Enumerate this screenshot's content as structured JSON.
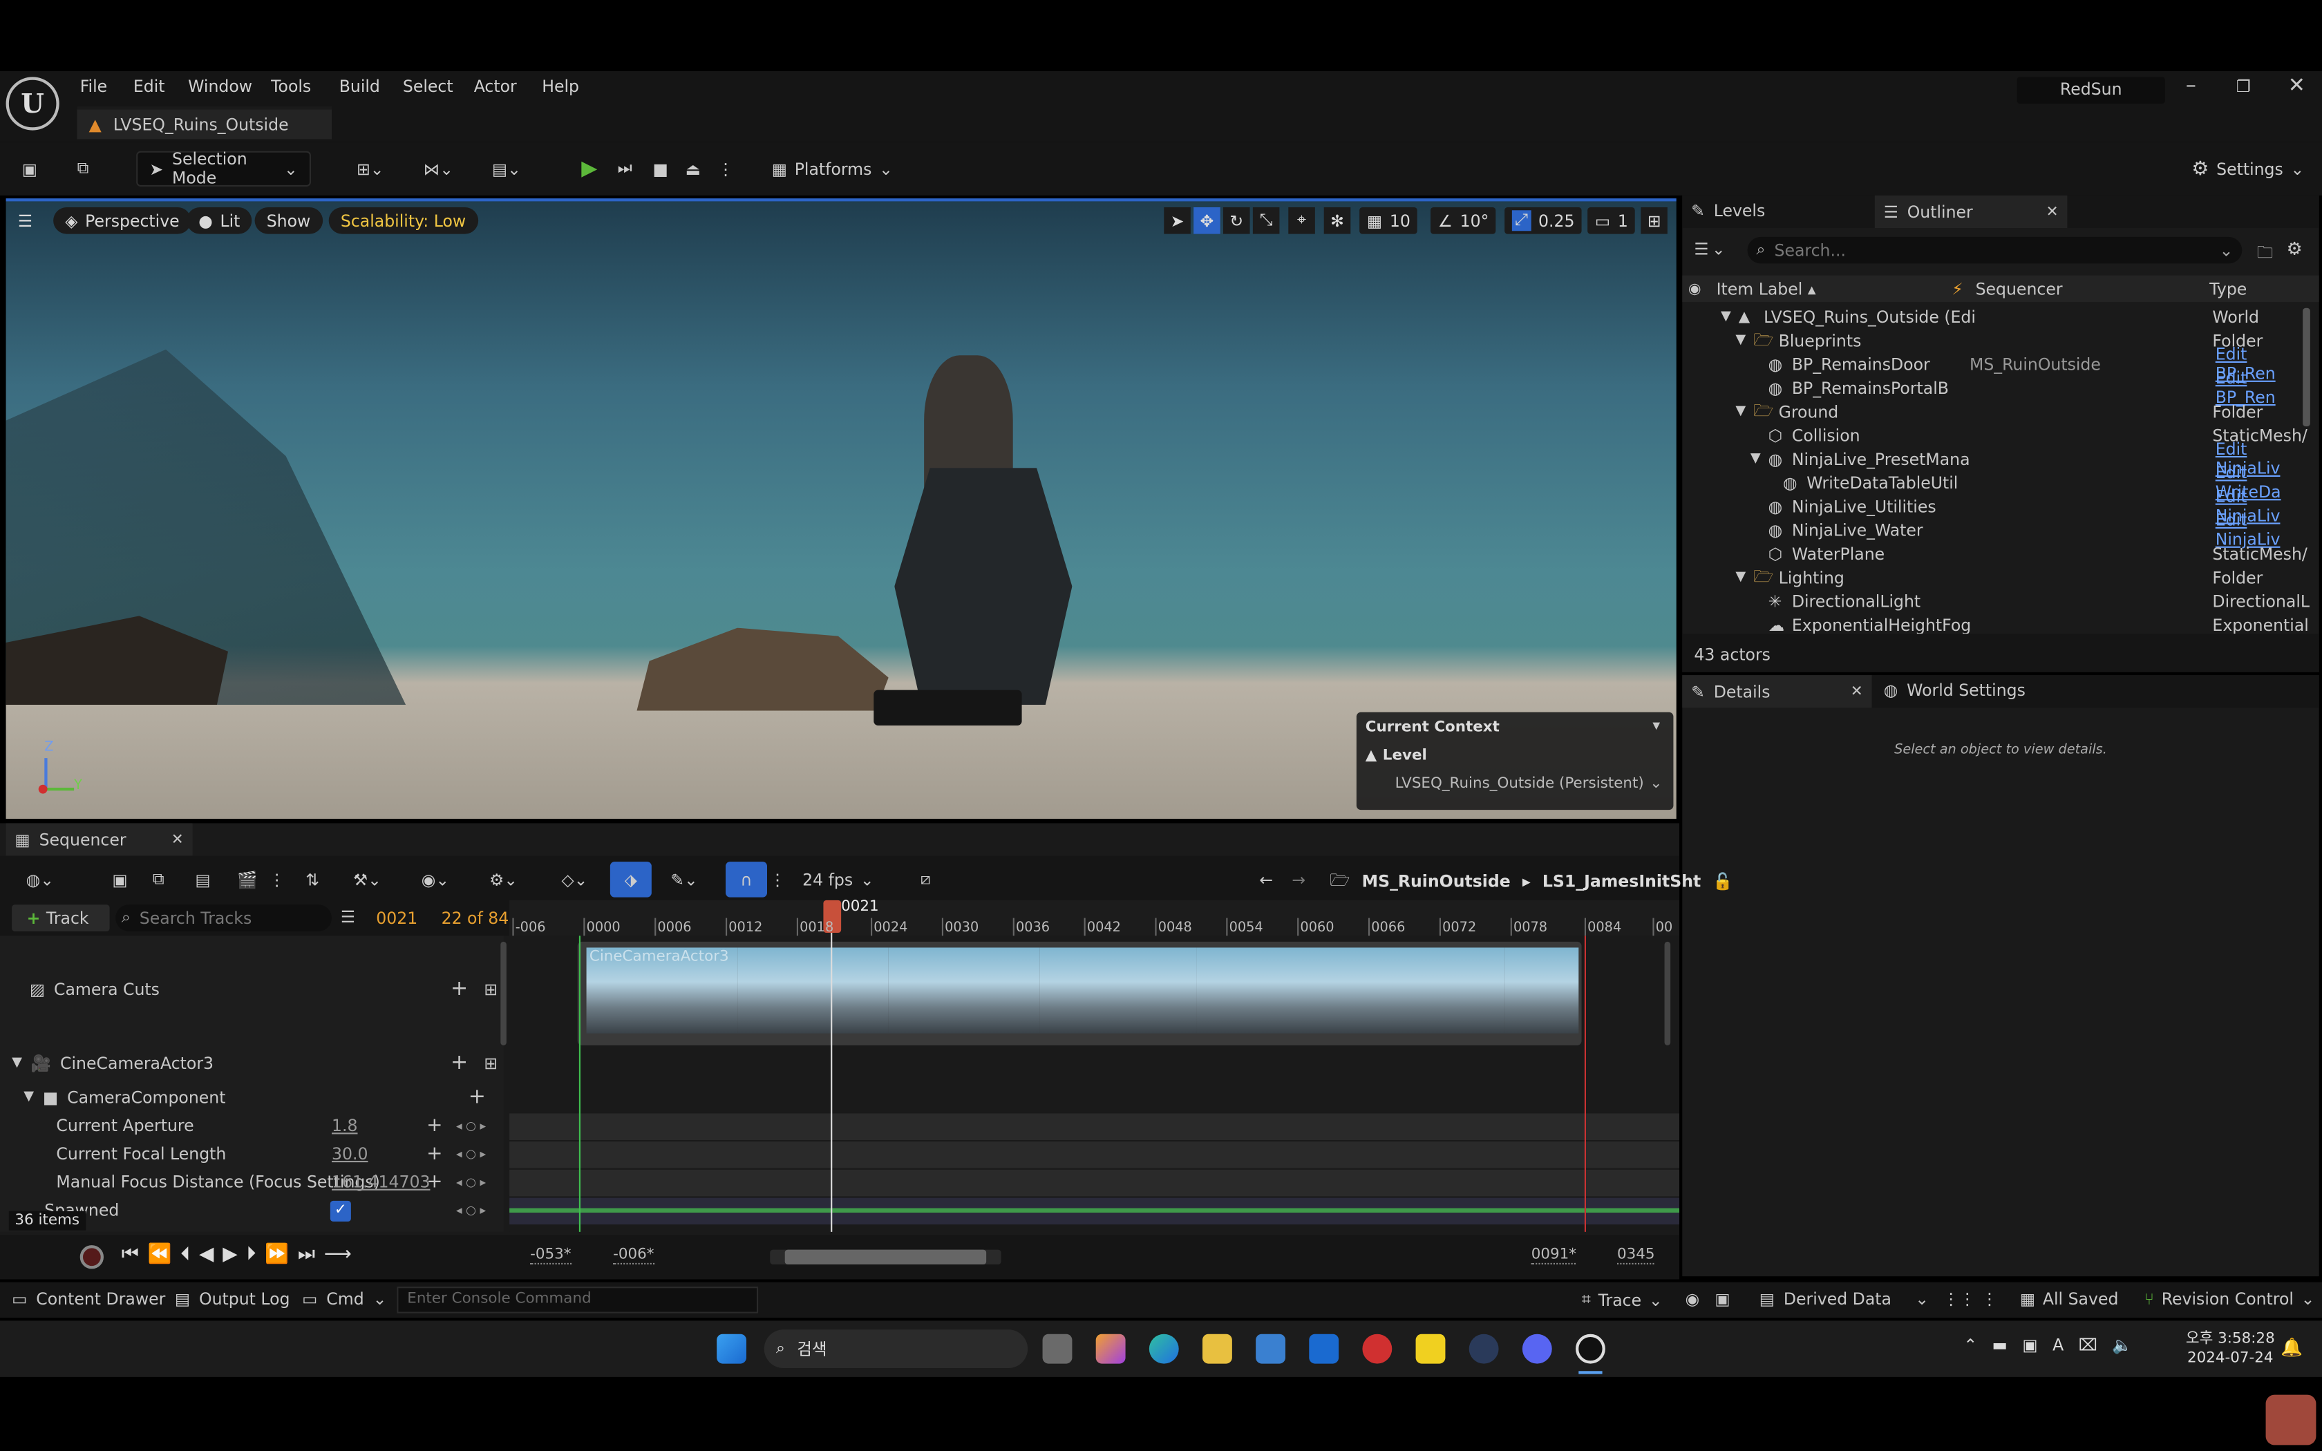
{
  "app": {
    "logo_text": "U",
    "level_tab": "LVSEQ_Ruins_Outside",
    "user": "RedSun"
  },
  "menu": [
    "File",
    "Edit",
    "Window",
    "Tools",
    "Build",
    "Select",
    "Actor",
    "Help"
  ],
  "toolbar": {
    "selection_mode": "Selection Mode",
    "platforms": "Platforms",
    "settings": "Settings"
  },
  "viewport": {
    "perspective": "Perspective",
    "lit": "Lit",
    "show": "Show",
    "scalability": "Scalability: Low",
    "grid_snap": "10",
    "rot_snap": "10°",
    "scale_snap": "0.25",
    "camera_speed": "1",
    "context_title": "Current Context",
    "context_level": "Level",
    "context_value": "LVSEQ_Ruins_Outside (Persistent)",
    "axis_z": "Z",
    "axis_y": "Y"
  },
  "levels_tab": "Levels",
  "outliner": {
    "tab": "Outliner",
    "search_placeholder": "Search...",
    "col_label": "Item Label ▴",
    "col_seq": "Sequencer",
    "col_type": "Type",
    "rows": [
      {
        "label": "LVSEQ_Ruins_Outside (Edi",
        "seq": "",
        "type": "World",
        "link": false
      },
      {
        "label": "Blueprints",
        "seq": "",
        "type": "Folder",
        "link": false
      },
      {
        "label": "BP_RemainsDoor",
        "seq": "MS_RuinOutside",
        "type": "Edit BP_Ren",
        "link": true
      },
      {
        "label": "BP_RemainsPortalB",
        "seq": "",
        "type": "Edit BP_Ren",
        "link": true
      },
      {
        "label": "Ground",
        "seq": "",
        "type": "Folder",
        "link": false
      },
      {
        "label": "Collision",
        "seq": "",
        "type": "StaticMesh/",
        "link": false
      },
      {
        "label": "NinjaLive_PresetMana",
        "seq": "",
        "type": "Edit NinjaLiv",
        "link": true
      },
      {
        "label": "WriteDataTableUtil",
        "seq": "",
        "type": "Edit WriteDa",
        "link": true
      },
      {
        "label": "NinjaLive_Utilities",
        "seq": "",
        "type": "Edit NinjaLiv",
        "link": true
      },
      {
        "label": "NinjaLive_Water",
        "seq": "",
        "type": "Edit NinjaLiv",
        "link": true
      },
      {
        "label": "WaterPlane",
        "seq": "",
        "type": "StaticMesh/",
        "link": false
      },
      {
        "label": "Lighting",
        "seq": "",
        "type": "Folder",
        "link": false
      },
      {
        "label": "DirectionalLight",
        "seq": "",
        "type": "DirectionalL",
        "link": false
      },
      {
        "label": "ExponentialHeightFog",
        "seq": "",
        "type": "Exponential",
        "link": false
      }
    ],
    "count": "43 actors"
  },
  "details": {
    "tab": "Details",
    "world_settings": "World Settings",
    "empty": "Select an object to view details."
  },
  "sequencer": {
    "tab": "Sequencer",
    "fps": "24 fps",
    "breadcrumb_1": "MS_RuinOutside",
    "breadcrumb_2": "LS1_JamesInitSht",
    "track_button": "Track",
    "search_placeholder": "Search Tracks",
    "current_frame": "0021",
    "frame_of": "22 of 84",
    "playhead_label": "0021",
    "ticks": [
      "-006",
      "0000",
      "0006",
      "0012",
      "0018",
      "0024",
      "0030",
      "0036",
      "0042",
      "0048",
      "0054",
      "0060",
      "0066",
      "0072",
      "0078",
      "0084",
      "00"
    ],
    "tracks": {
      "camera_cuts": "Camera Cuts",
      "camera_actor": "CineCameraActor3",
      "camera_component": "CameraComponent",
      "aperture_label": "Current Aperture",
      "aperture_value": "1.8",
      "focal_label": "Current Focal Length",
      "focal_value": "30.0",
      "focus_label": "Manual Focus Distance (Focus Settings)",
      "focus_value": "161.414703",
      "spawned_label": "Spawned"
    },
    "clip_label": "CineCameraActor3",
    "items_count": "36 items",
    "range_start": "-053*",
    "range_view_start": "-006*",
    "range_view_end": "0091*",
    "range_end": "0345"
  },
  "statusbar": {
    "content_drawer": "Content Drawer",
    "output_log": "Output Log",
    "cmd": "Cmd",
    "console_placeholder": "Enter Console Command",
    "trace": "Trace",
    "derived_data": "Derived Data",
    "all_saved": "All Saved",
    "revision_control": "Revision Control"
  },
  "taskbar": {
    "search": "검색",
    "time": "오후 3:58:28",
    "date": "2024-07-24"
  }
}
